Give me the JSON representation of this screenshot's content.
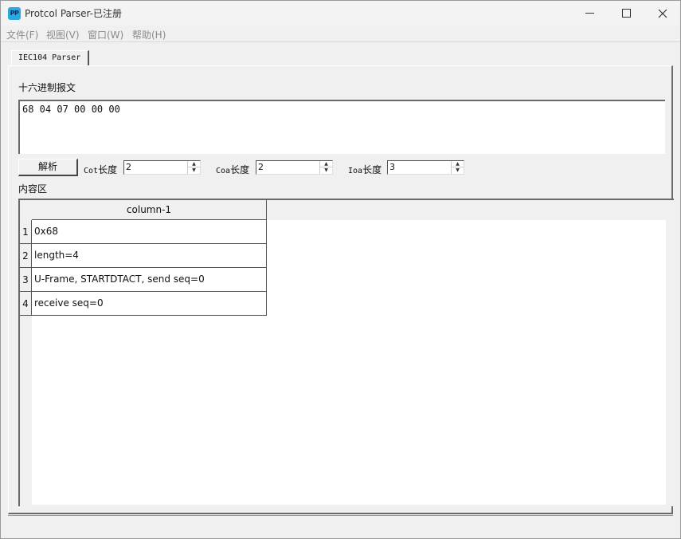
{
  "window": {
    "title": "Protcol Parser-已注册",
    "icon_text": "PP"
  },
  "menu": {
    "items": [
      "文件(F)",
      "视图(V)",
      "窗口(W)",
      "帮助(H)"
    ]
  },
  "tabs": [
    {
      "label": "IEC104 Parser"
    }
  ],
  "hex": {
    "label": "十六进制报文",
    "value": "68 04 07 00 00 00"
  },
  "controls": {
    "parse_label": "解析",
    "cot": {
      "label_prefix": "Cot",
      "label_suffix": "长度",
      "value": "2"
    },
    "coa": {
      "label_prefix": "Coa",
      "label_suffix": "长度",
      "value": "2"
    },
    "ioa": {
      "label_prefix": "Ioa",
      "label_suffix": "长度",
      "value": "3"
    }
  },
  "content": {
    "label": "内容区",
    "column_header": "column-1",
    "rows": [
      {
        "num": "1",
        "value": "0x68"
      },
      {
        "num": "2",
        "value": "length=4"
      },
      {
        "num": "3",
        "value": "U-Frame, STARTDTACT, send seq=0"
      },
      {
        "num": "4",
        "value": "receive seq=0"
      }
    ]
  },
  "icons": {
    "app": "pp-app-icon",
    "minimize": "minimize-icon",
    "maximize": "maximize-icon",
    "close": "close-icon"
  }
}
